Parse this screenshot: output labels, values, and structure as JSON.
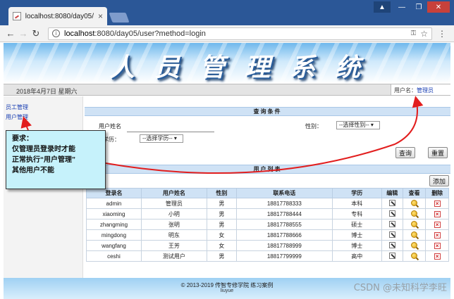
{
  "browser": {
    "tab_title": "localhost:8080/day05/",
    "tab_close": "×",
    "url_host": "localhost",
    "url_rest": ":8080/day05/user?method=login",
    "window_controls": [
      "▲",
      "—",
      "❐",
      "✕"
    ]
  },
  "page": {
    "banner_title": "人员管理系统",
    "date": "2018年4月7日 星期六",
    "user_label": "用户名：",
    "user_name": "管理员",
    "sidebar": {
      "items": [
        {
          "label": "员工管理"
        },
        {
          "label": "用户管理"
        }
      ]
    },
    "query": {
      "title": "查询条件",
      "name_label": "用户姓名",
      "name_value": "",
      "gender_label": "性别：",
      "gender_selected": "--选择性别--",
      "edu_label": "学历：",
      "edu_selected": "--选择学历--",
      "search_button": "查询",
      "reset_button": "重置"
    },
    "list": {
      "title": "用户列表",
      "add_button": "添加",
      "columns": [
        "登录名",
        "用户姓名",
        "性别",
        "联系电话",
        "学历",
        "编辑",
        "查看",
        "删除"
      ],
      "rows": [
        {
          "login": "admin",
          "name": "管理员",
          "gender": "男",
          "phone": "18817788333",
          "edu": "本科"
        },
        {
          "login": "xiaoming",
          "name": "小明",
          "gender": "男",
          "phone": "18817788444",
          "edu": "专科"
        },
        {
          "login": "zhangming",
          "name": "张明",
          "gender": "男",
          "phone": "18817788555",
          "edu": "硕士"
        },
        {
          "login": "mingdong",
          "name": "明东",
          "gender": "女",
          "phone": "18817788666",
          "edu": "博士"
        },
        {
          "login": "wangfang",
          "name": "王芳",
          "gender": "女",
          "phone": "18817788999",
          "edu": "博士"
        },
        {
          "login": "ceshi",
          "name": "测试用户",
          "gender": "男",
          "phone": "18817799999",
          "edu": "高中"
        }
      ]
    },
    "footer": {
      "copyright": "© 2013-2019 传智专修学院 练习案例",
      "author": "liuyue"
    }
  },
  "callout": {
    "lines": [
      "要求：",
      "仅管理员登录时才能",
      "正常执行“用户管理”",
      "其他用户不能"
    ]
  },
  "watermark": "CSDN @未知科学李旺",
  "colors": {
    "titlebar": "#2b5797",
    "banner_top": "#6fb8ec",
    "section_head": "#cfe2f5",
    "callout_bg": "#c6f2fb",
    "arrow": "#e21e1e",
    "link": "#1a3fb3"
  }
}
